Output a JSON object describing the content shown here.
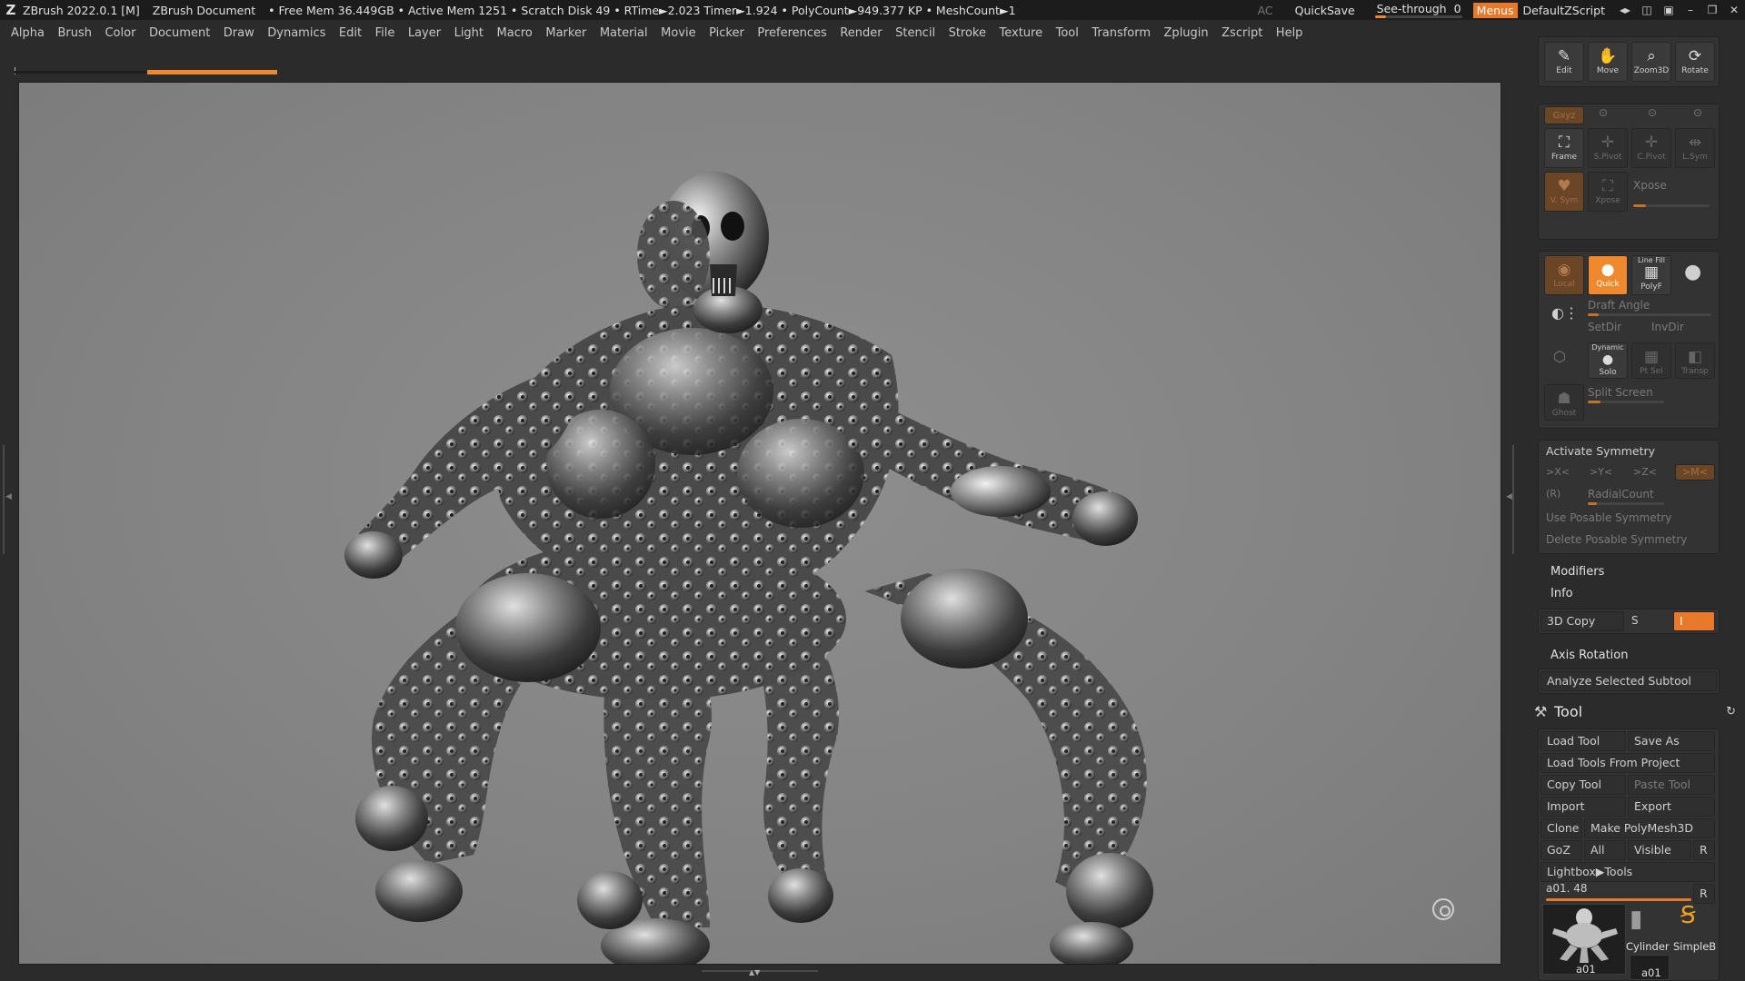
{
  "titlebar": {
    "app": "ZBrush 2022.0.1 [M]",
    "document": "ZBrush Document",
    "stats": "• Free Mem 36.449GB • Active Mem 1251 • Scratch Disk 49 • RTime►2.023 Timer►1.924 • PolyCount►949.377 KP • MeshCount►1",
    "ac": "AC",
    "quicksave": "QuickSave",
    "see_through_label": "See-through",
    "see_through_value": "0",
    "menus": "Menus",
    "default_zscript": "DefaultZScript"
  },
  "menubar": [
    "Alpha",
    "Brush",
    "Color",
    "Document",
    "Draw",
    "Dynamics",
    "Edit",
    "File",
    "Layer",
    "Light",
    "Macro",
    "Marker",
    "Material",
    "Movie",
    "Picker",
    "Preferences",
    "Render",
    "Stencil",
    "Stroke",
    "Texture",
    "Tool",
    "Transform",
    "Zplugin",
    "Zscript",
    "Help"
  ],
  "nav_buttons": [
    "Edit",
    "Move",
    "Zoom3D",
    "Rotate"
  ],
  "view_buttons": {
    "xyz": "Gxyz",
    "frame": "Frame",
    "spivot": "S.Pivot",
    "cpivot": "C.Pivot",
    "lsym": "L.Sym",
    "vsym": "V. Sym",
    "xpose_btn": "Xpose",
    "xpose_lbl": "Xpose"
  },
  "draw_buttons": {
    "local": "Local",
    "quick": "Quick",
    "line_fill": "Line Fill",
    "polyf": "PolyF",
    "draft_angle": "Draft Angle",
    "setdir": "SetDir",
    "invdir": "InvDir",
    "dynamic": "Dynamic",
    "solo": "Solo",
    "ptsel": "Pt Sel",
    "transp": "Transp",
    "ghost": "Ghost",
    "split_screen": "Split Screen"
  },
  "symmetry": {
    "activate": "Activate Symmetry",
    "x": ">X<",
    "y": ">Y<",
    "z": ">Z<",
    "m": ">M<",
    "r": "(R)",
    "radial_count": "RadialCount",
    "use_posable": "Use Posable Symmetry",
    "delete_posable": "Delete Posable Symmetry"
  },
  "sections": {
    "modifiers": "Modifiers",
    "info": "Info",
    "copy3d": "3D Copy",
    "s": "S",
    "axis_rotation": "Axis Rotation",
    "analyze": "Analyze Selected Subtool"
  },
  "tool": {
    "title": "Tool",
    "load_tool": "Load Tool",
    "save_as": "Save As",
    "load_from_project": "Load Tools From Project",
    "copy_tool": "Copy Tool",
    "paste_tool": "Paste Tool",
    "import": "Import",
    "export": "Export",
    "clone": "Clone",
    "make_polymesh": "Make PolyMesh3D",
    "goz": "GoZ",
    "all": "All",
    "visible": "Visible",
    "r": "R",
    "lightbox": "Lightbox▶Tools",
    "current": "a01. 48",
    "current_r": "R",
    "thumbs": [
      "a01",
      "Cylinder",
      "SimpleB",
      "a01"
    ]
  }
}
